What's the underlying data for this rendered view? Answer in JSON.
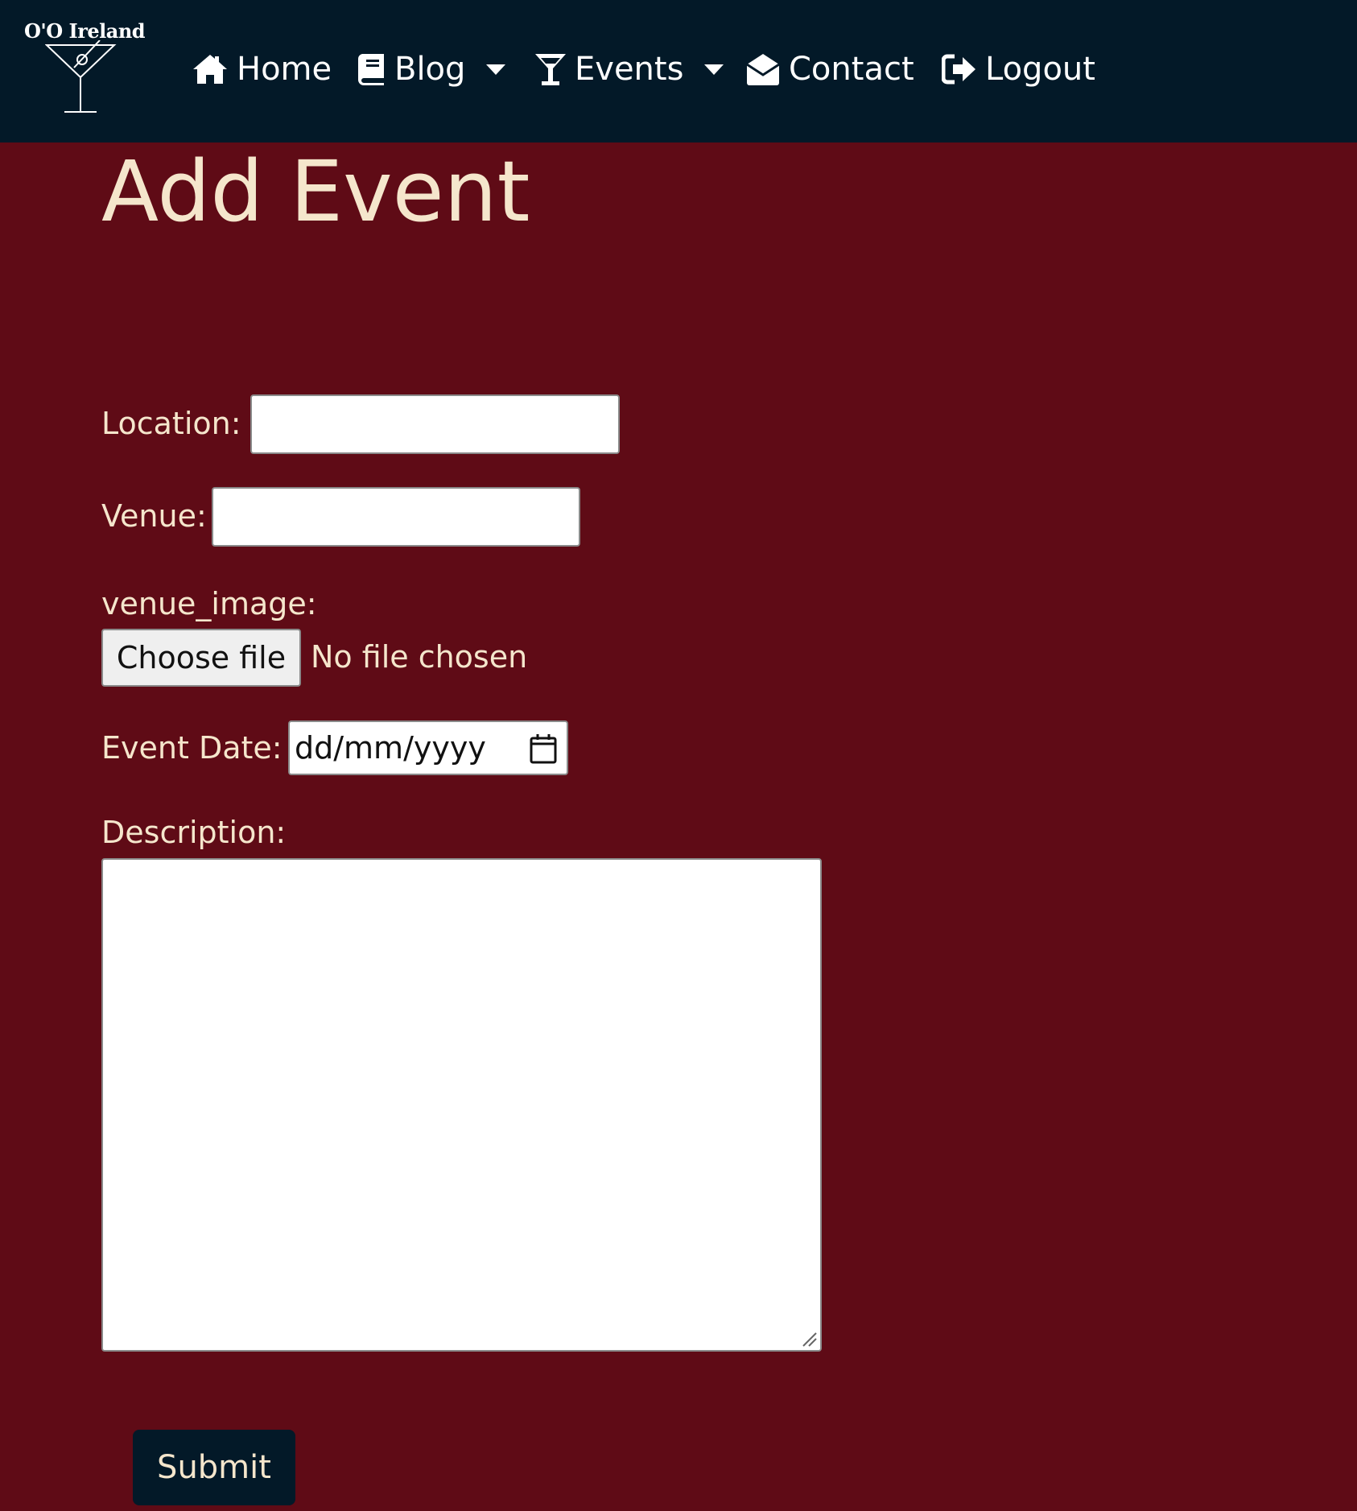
{
  "navbar": {
    "brand": "O'O Ireland",
    "items": [
      {
        "label": "Home",
        "icon": "home-icon"
      },
      {
        "label": "Blog",
        "icon": "book-icon",
        "dropdown": true
      },
      {
        "label": "Events",
        "icon": "cocktail-icon",
        "dropdown": true
      },
      {
        "label": "Contact",
        "icon": "envelope-open-icon"
      },
      {
        "label": "Logout",
        "icon": "sign-out-icon"
      }
    ]
  },
  "page": {
    "title": "Add Event"
  },
  "form": {
    "location_label": "Location:",
    "location_value": "",
    "venue_label": "Venue:",
    "venue_value": "",
    "venue_image_label": "venue_image:",
    "choose_file_label": "Choose file",
    "file_status": "No file chosen",
    "event_date_label": "Event Date:",
    "event_date_placeholder": "dd/mm/yyyy",
    "description_label": "Description:",
    "description_value": "",
    "submit_label": "Submit"
  },
  "colors": {
    "navbar_bg": "#031928",
    "page_bg": "#5f0b16",
    "text_cream": "#f5e6cc",
    "button_bg": "#031928"
  }
}
